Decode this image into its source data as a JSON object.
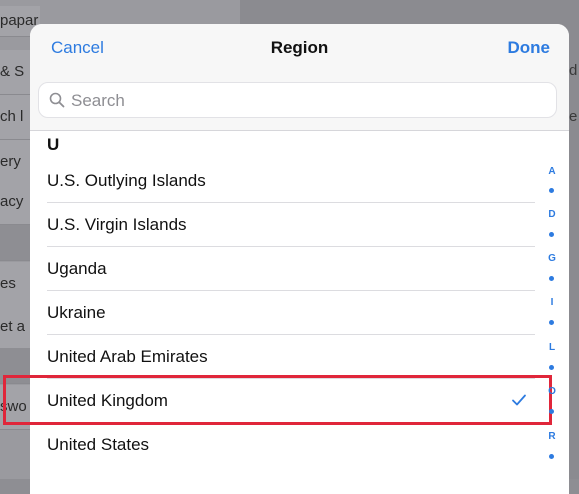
{
  "background": {
    "left_fragments": [
      "papar",
      "& S",
      "ch l",
      "ery",
      "acy",
      "es",
      "et a",
      "swo"
    ],
    "right_fragments": [
      "d",
      "e"
    ]
  },
  "nav": {
    "cancel_label": "Cancel",
    "title": "Region",
    "done_label": "Done"
  },
  "search": {
    "placeholder": "Search",
    "value": ""
  },
  "list": {
    "section": "U",
    "items": [
      {
        "label": "U.S. Outlying Islands",
        "selected": false
      },
      {
        "label": "U.S. Virgin Islands",
        "selected": false
      },
      {
        "label": "Uganda",
        "selected": false
      },
      {
        "label": "Ukraine",
        "selected": false
      },
      {
        "label": "United Arab Emirates",
        "selected": false
      },
      {
        "label": "United Kingdom",
        "selected": true
      },
      {
        "label": "United States",
        "selected": false
      }
    ]
  },
  "index": {
    "letters": [
      "A",
      "D",
      "G",
      "I",
      "L",
      "O",
      "R"
    ]
  },
  "icons": {
    "search": "search-icon",
    "check": "checkmark-icon"
  },
  "colors": {
    "accent": "#2d7be0",
    "highlight": "#e0263a"
  }
}
